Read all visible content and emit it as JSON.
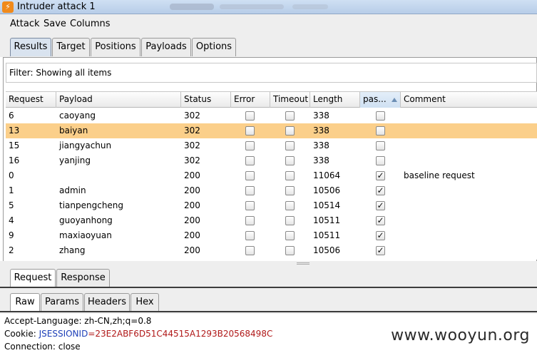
{
  "window": {
    "title": "Intruder attack 1"
  },
  "menu": [
    "Attack",
    "Save",
    "Columns"
  ],
  "main_tabs": [
    {
      "label": "Results",
      "active": true
    },
    {
      "label": "Target",
      "active": false
    },
    {
      "label": "Positions",
      "active": false
    },
    {
      "label": "Payloads",
      "active": false
    },
    {
      "label": "Options",
      "active": false
    }
  ],
  "filter": {
    "text": "Filter: Showing all items"
  },
  "table": {
    "columns": [
      "Request",
      "Payload",
      "Status",
      "Error",
      "Timeout",
      "Length",
      "pas...",
      "Comment"
    ],
    "sorted_column": "pas...",
    "rows": [
      {
        "request": "6",
        "payload": "caoyang",
        "status": "302",
        "error": false,
        "timeout": false,
        "length": "338",
        "pass": false,
        "comment": "",
        "selected": false
      },
      {
        "request": "13",
        "payload": "baiyan",
        "status": "302",
        "error": false,
        "timeout": false,
        "length": "338",
        "pass": false,
        "comment": "",
        "selected": true
      },
      {
        "request": "15",
        "payload": "jiangyachun",
        "status": "302",
        "error": false,
        "timeout": false,
        "length": "338",
        "pass": false,
        "comment": "",
        "selected": false
      },
      {
        "request": "16",
        "payload": "yanjing",
        "status": "302",
        "error": false,
        "timeout": false,
        "length": "338",
        "pass": false,
        "comment": "",
        "selected": false
      },
      {
        "request": "0",
        "payload": "",
        "status": "200",
        "error": false,
        "timeout": false,
        "length": "11064",
        "pass": true,
        "comment": "baseline request",
        "selected": false
      },
      {
        "request": "1",
        "payload": "admin",
        "status": "200",
        "error": false,
        "timeout": false,
        "length": "10506",
        "pass": true,
        "comment": "",
        "selected": false
      },
      {
        "request": "5",
        "payload": "tianpengcheng",
        "status": "200",
        "error": false,
        "timeout": false,
        "length": "10514",
        "pass": true,
        "comment": "",
        "selected": false
      },
      {
        "request": "4",
        "payload": "guoyanhong",
        "status": "200",
        "error": false,
        "timeout": false,
        "length": "10511",
        "pass": true,
        "comment": "",
        "selected": false
      },
      {
        "request": "9",
        "payload": "maxiaoyuan",
        "status": "200",
        "error": false,
        "timeout": false,
        "length": "10511",
        "pass": true,
        "comment": "",
        "selected": false
      },
      {
        "request": "2",
        "payload": "zhang",
        "status": "200",
        "error": false,
        "timeout": false,
        "length": "10506",
        "pass": true,
        "comment": "",
        "selected": false
      }
    ]
  },
  "detail_tabs": [
    {
      "label": "Request",
      "active": true
    },
    {
      "label": "Response",
      "active": false
    }
  ],
  "view_tabs": [
    {
      "label": "Raw",
      "active": true
    },
    {
      "label": "Params",
      "active": false
    },
    {
      "label": "Headers",
      "active": false
    },
    {
      "label": "Hex",
      "active": false
    }
  ],
  "raw": {
    "line1": "Accept-Language: zh-CN,zh;q=0.8",
    "line2_prefix": "Cookie: ",
    "line2_key": "JSESSIONID",
    "line2_value": "=23E2ABF6D51C44515A1293B20568498C",
    "line3": "Connection: close"
  },
  "watermark": "www.wooyun.org",
  "colors": {
    "selected_row": "#fbcf8a",
    "cookie_key": "#1d3fb8",
    "cookie_value": "#b01818"
  }
}
